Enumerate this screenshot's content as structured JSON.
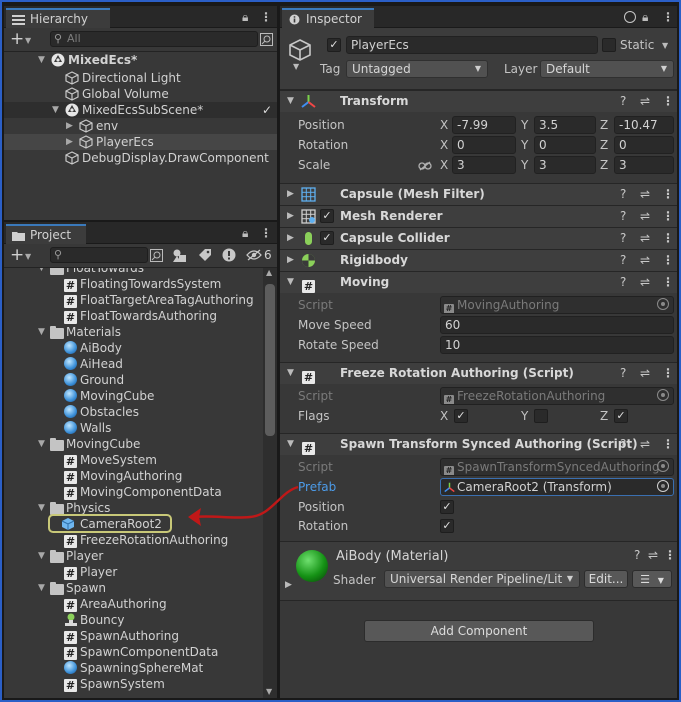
{
  "hierarchy": {
    "tab_label": "Hierarchy",
    "search_placeholder": "All",
    "items": [
      {
        "label": "MixedEcs*"
      },
      {
        "label": "Directional Light"
      },
      {
        "label": "Global Volume"
      },
      {
        "label": "MixedEcsSubScene*"
      },
      {
        "label": "env"
      },
      {
        "label": "PlayerEcs"
      },
      {
        "label": "DebugDisplay.DrawComponent"
      }
    ]
  },
  "project": {
    "tab_label": "Project",
    "hidden_count": "6",
    "items": [
      {
        "label": "FloatTowards"
      },
      {
        "label": "FloatingTowardsSystem"
      },
      {
        "label": "FloatTargetAreaTagAuthoring"
      },
      {
        "label": "FloatTowardsAuthoring"
      },
      {
        "label": "Materials"
      },
      {
        "label": "AiBody"
      },
      {
        "label": "AiHead"
      },
      {
        "label": "Ground"
      },
      {
        "label": "MovingCube"
      },
      {
        "label": "Obstacles"
      },
      {
        "label": "Walls"
      },
      {
        "label": "MovingCube"
      },
      {
        "label": "MoveSystem"
      },
      {
        "label": "MovingAuthoring"
      },
      {
        "label": "MovingComponentData"
      },
      {
        "label": "Physics"
      },
      {
        "label": "CameraRoot2"
      },
      {
        "label": "FreezeRotationAuthoring"
      },
      {
        "label": "Player"
      },
      {
        "label": "Player"
      },
      {
        "label": "Spawn"
      },
      {
        "label": "AreaAuthoring"
      },
      {
        "label": "Bouncy"
      },
      {
        "label": "SpawnAuthoring"
      },
      {
        "label": "SpawnComponentData"
      },
      {
        "label": "SpawningSphereMat"
      },
      {
        "label": "SpawnSystem"
      }
    ]
  },
  "inspector": {
    "tab_label": "Inspector",
    "object_name": "PlayerEcs",
    "static_label": "Static",
    "tag_label": "Tag",
    "tag_value": "Untagged",
    "layer_label": "Layer",
    "layer_value": "Default",
    "transform": {
      "title": "Transform",
      "position_label": "Position",
      "rotation_label": "Rotation",
      "scale_label": "Scale",
      "x": "X",
      "y": "Y",
      "z": "Z",
      "position": [
        "-7.99",
        "3.5",
        "-10.47"
      ],
      "rotation": [
        "0",
        "0",
        "0"
      ],
      "scale": [
        "3",
        "3",
        "3"
      ]
    },
    "mesh_filter": {
      "title": "Capsule (Mesh Filter)"
    },
    "mesh_renderer": {
      "title": "Mesh Renderer"
    },
    "capsule_collider": {
      "title": "Capsule Collider"
    },
    "rigidbody": {
      "title": "Rigidbody"
    },
    "moving": {
      "title": "Moving",
      "script_label": "Script",
      "script_value": "MovingAuthoring",
      "move_speed_label": "Move Speed",
      "move_speed": "60",
      "rotate_speed_label": "Rotate Speed",
      "rotate_speed": "10"
    },
    "freeze": {
      "title": "Freeze Rotation Authoring (Script)",
      "script_label": "Script",
      "script_value": "FreezeRotationAuthoring",
      "flags_label": "Flags",
      "x": "X",
      "y": "Y",
      "z": "Z"
    },
    "spawn": {
      "title": "Spawn Transform Synced Authoring (Script)",
      "script_label": "Script",
      "script_value": "SpawnTransformSyncedAuthoring",
      "prefab_label": "Prefab",
      "prefab_value": "CameraRoot2 (Transform)",
      "position_label": "Position",
      "rotation_label": "Rotation"
    },
    "material": {
      "title": "AiBody (Material)",
      "shader_label": "Shader",
      "shader_value": "Universal Render Pipeline/Lit",
      "edit_label": "Edit..."
    },
    "add_component_label": "Add Component"
  },
  "colors": {
    "frame": "#2b5fc7",
    "selection_ring": "#c8c878",
    "arrow": "#c01818",
    "link": "#4c9be8"
  }
}
